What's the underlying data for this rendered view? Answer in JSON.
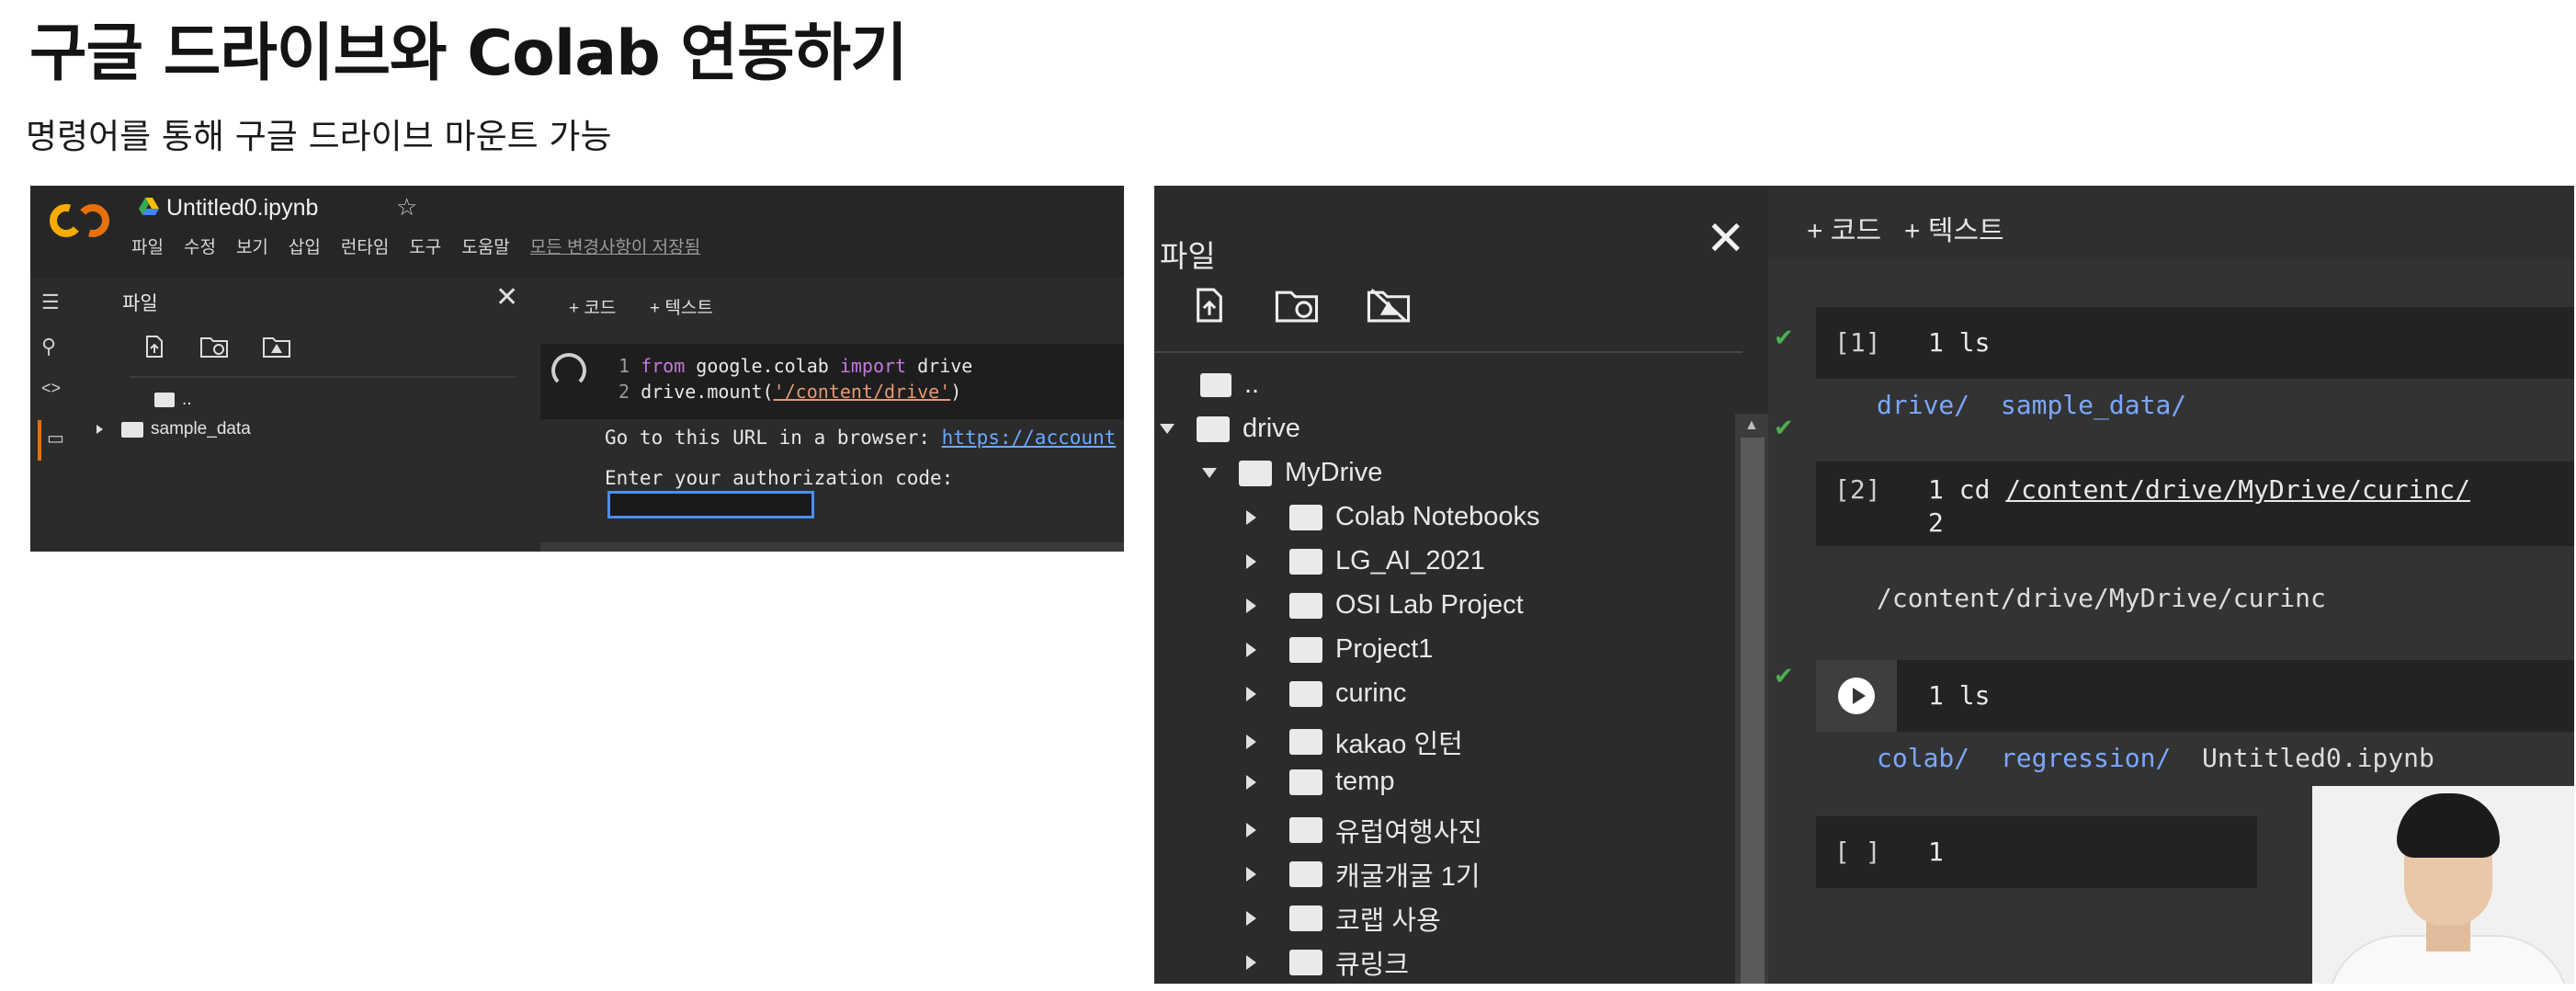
{
  "slide": {
    "title": "구글 드라이브와 Colab 연동하기",
    "subtitle": "명령어를 통해 구글 드라이브 마운트 가능"
  },
  "left_shot": {
    "notebook_title": "Untitled0.ipynb",
    "menu": [
      "파일",
      "수정",
      "보기",
      "삽입",
      "런타임",
      "도구",
      "도움말"
    ],
    "saved_status": "모든 변경사항이 저장됨",
    "files_label": "파일",
    "tree": [
      {
        "label": ".."
      },
      {
        "label": "sample_data"
      }
    ],
    "toolbar": {
      "code": "+ 코드",
      "text": "+ 텍스트"
    },
    "code_lines": [
      {
        "num": "1",
        "pre": "from",
        "mid": " google.colab ",
        "kw2": "import",
        "post": " drive"
      },
      {
        "num": "2",
        "pre": "drive.mount(",
        "str": "'/content/drive'",
        "post": ")"
      }
    ],
    "output_url_label": "Go to this URL in a browser: ",
    "output_url": "https://account",
    "auth_prompt": "Enter your authorization code:"
  },
  "right_shot": {
    "files_label": "파일",
    "toolbar": {
      "code": "+ 코드",
      "text": "+ 텍스트"
    },
    "tree": [
      {
        "label": "..",
        "level": 0,
        "arrow": "none"
      },
      {
        "label": "drive",
        "level": 0,
        "arrow": "down"
      },
      {
        "label": "MyDrive",
        "level": 1,
        "arrow": "down"
      },
      {
        "label": "Colab Notebooks",
        "level": 2,
        "arrow": "right"
      },
      {
        "label": "LG_AI_2021",
        "level": 2,
        "arrow": "right"
      },
      {
        "label": "OSI Lab Project",
        "level": 2,
        "arrow": "right"
      },
      {
        "label": "Project1",
        "level": 2,
        "arrow": "right"
      },
      {
        "label": "curinc",
        "level": 2,
        "arrow": "right"
      },
      {
        "label": "kakao 인턴",
        "level": 2,
        "arrow": "right"
      },
      {
        "label": "temp",
        "level": 2,
        "arrow": "right"
      },
      {
        "label": "유럽여행사진",
        "level": 2,
        "arrow": "right"
      },
      {
        "label": "캐굴개굴 1기",
        "level": 2,
        "arrow": "right"
      },
      {
        "label": "코랩 사용",
        "level": 2,
        "arrow": "right"
      },
      {
        "label": "큐링크",
        "level": 2,
        "arrow": "right"
      }
    ],
    "cells": [
      {
        "exec": "[1]",
        "line1": "1 ls",
        "output": [
          "drive/",
          "sample_data/"
        ]
      },
      {
        "exec": "[2]",
        "line1": "1 cd ",
        "path": "/content/drive/MyDrive/curinc/",
        "line2": "2",
        "output_text": "/content/drive/MyDrive/curinc"
      },
      {
        "exec": "",
        "line1": "1 ls",
        "output": [
          "colab/",
          "regression/"
        ],
        "output_file": "Untitled0.ipynb"
      },
      {
        "exec": "[ ]",
        "line1": "1"
      }
    ]
  },
  "colors": {
    "colab_orange": "#f9ab00",
    "colab_dark": "#e8710a",
    "dir_blue": "#7ba7ff",
    "check_green": "#4caf50"
  }
}
